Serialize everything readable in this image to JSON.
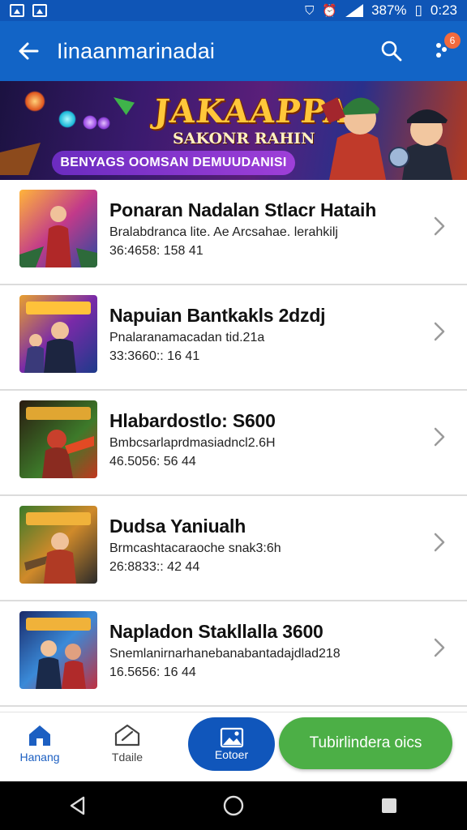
{
  "status_bar": {
    "battery": "387%",
    "time": "0:23"
  },
  "app_bar": {
    "title": "Iinaanmarinadai",
    "notification_count": "6"
  },
  "banner": {
    "title": "JAKAAPPA",
    "subtitle": "SAKONR RAHIN",
    "strip_text": "BENYAGS OOMSAN DEMUUDANISI"
  },
  "list": {
    "items": [
      {
        "title": "Ponaran Nadalan Stlacr Hataih",
        "subtitle": "Bralabdranca lite. Ae Arcsahae. lerahkilj",
        "meta": "36:4658: 158  41"
      },
      {
        "title": "Napuian Bantkakls 2dzdj",
        "subtitle": "Pnalaranamacadan tid.21a",
        "meta": "33:3660:: 16  41"
      },
      {
        "title": "Hlabardostlo: S600",
        "subtitle": "Bmbcsarlaprdmasiadncl2.6H",
        "meta": "46.5056: 56  44"
      },
      {
        "title": "Dudsa Yaniualh",
        "subtitle": "Brmcashtacaraoche snak3:6h",
        "meta": "26:8833:: 42  44"
      },
      {
        "title": "Napladon Stakllalla 3600",
        "subtitle": "Snemlanirnarhanebanabantadajdlad218",
        "meta": "16.5656: 16  44"
      }
    ]
  },
  "bottom_nav": {
    "home_label": "Hanang",
    "update_label": "Tdaile",
    "primary_label": "Eotoer",
    "green_label": "Tubirlindera oics"
  },
  "colors": {
    "accent": "#1264c6",
    "green": "#4caf46",
    "badge": "#f26a3d"
  }
}
